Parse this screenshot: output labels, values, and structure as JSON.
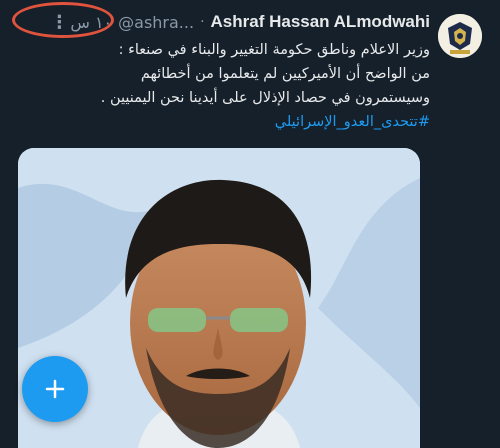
{
  "header": {
    "display_name": "Ashraf Hassan ALmodwahi",
    "handle": "@ashra...",
    "separator": "·",
    "timestamp": "١٠ س",
    "more_icon": "more-vertical-icon"
  },
  "tweet": {
    "lines": [
      "وزير الاعلام وناطق حكومة التغيير والبناء في صنعاء :",
      "من الواضح أن الأميركيين لم يتعلموا من أخطائهم",
      "وسيستمرون في حصاد الإذلال على أيدينا نحن اليمنيين ."
    ],
    "hashtag": "#تتحدى_العدو_الإسرائيلي"
  },
  "avatar": {
    "icon": "emblem-avatar-icon"
  },
  "media": {
    "description_icon": "photo-icon"
  },
  "fab": {
    "icon": "plus-icon",
    "color": "#1d9bf0"
  },
  "colors": {
    "background": "#15202b",
    "text": "#e7e9ea",
    "muted": "#8b98a5",
    "accent": "#1d9bf0",
    "highlight": "#e0533c"
  }
}
